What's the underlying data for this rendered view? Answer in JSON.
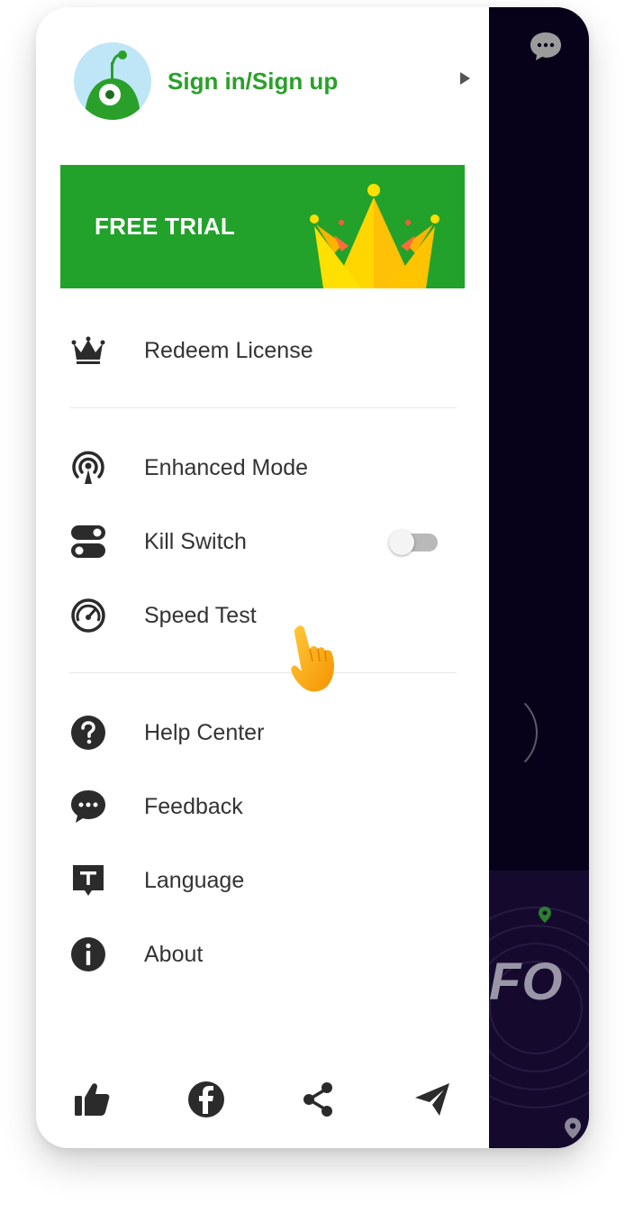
{
  "profile": {
    "sign_in_label": "Sign in/Sign up",
    "avatar_icon": "robot-avatar-icon",
    "arrow_icon": "play-right-icon"
  },
  "banner": {
    "label": "FREE TRIAL",
    "icon": "crown-icon",
    "color": "#22a22a"
  },
  "menu": {
    "redeem": {
      "label": "Redeem License",
      "icon": "crown-outline-icon"
    },
    "enhanced": {
      "label": "Enhanced Mode",
      "icon": "broadcast-icon"
    },
    "kill_switch": {
      "label": "Kill Switch",
      "icon": "switch-icon",
      "enabled": false
    },
    "speed_test": {
      "label": "Speed Test",
      "icon": "speedometer-icon"
    },
    "help": {
      "label": "Help Center",
      "icon": "question-icon"
    },
    "feedback": {
      "label": "Feedback",
      "icon": "chat-dots-icon"
    },
    "language": {
      "label": "Language",
      "icon": "text-bubble-icon"
    },
    "about": {
      "label": "About",
      "icon": "info-icon"
    }
  },
  "footer": {
    "icons": [
      "thumbs-up-icon",
      "facebook-icon",
      "share-icon",
      "send-icon"
    ]
  },
  "background_app": {
    "partial_text": "FO"
  },
  "colors": {
    "accent": "#2aa02a",
    "icon": "#333333",
    "backdrop": "#07021a"
  }
}
